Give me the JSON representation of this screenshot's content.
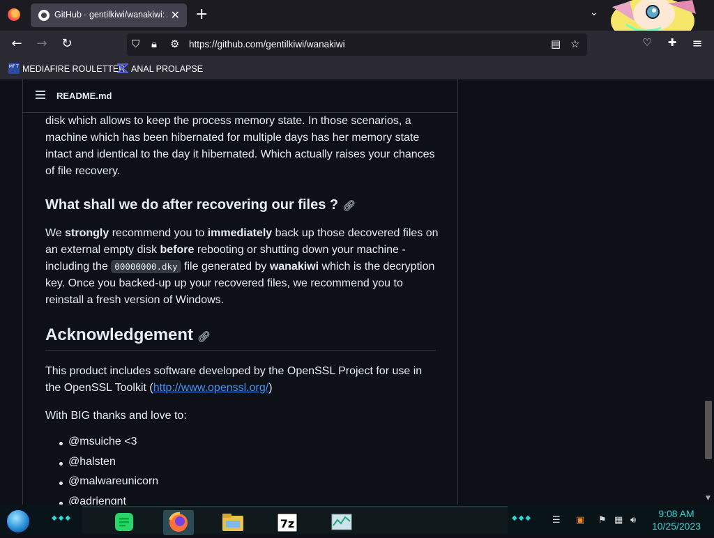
{
  "browser": {
    "tab_title": "GitHub - gentilkiwi/wanakiwi: A",
    "tab_close": "✕",
    "new_tab": "+",
    "url": "https://github.com/gentilkiwi/wanakiwi"
  },
  "bookmarks": [
    {
      "label": "MEDIAFIRE ROULETTER",
      "icon_text": "MF T"
    },
    {
      "label": "ANAL PROLAPSE"
    }
  ],
  "readme": {
    "file_name": "README.md",
    "para1": "disk which allows to keep the process memory state. In those scenarios, a machine which has been hibernated for multiple days has her memory state intact and identical to the day it hibernated. Which actually raises your chances of file recovery.",
    "h3": "What shall we do after recovering our files ?",
    "p2": {
      "t1": "We ",
      "b1": "strongly",
      "t2": " recommend you to ",
      "b2": "immediately",
      "t3": " back up those decovered files on an external empty disk ",
      "b3": "before",
      "t4": " rebooting or shutting down your machine - including the ",
      "code": "00000000.dky",
      "t5": " file generated by ",
      "b4": "wanakiwi",
      "t6": " which is the decryption key. Once you backed-up up your recovered files, we recommend you to reinstall a fresh version of Windows."
    },
    "h2": "Acknowledgement",
    "p3": {
      "t1": "This product includes software developed by the OpenSSL Project for use in the OpenSSL Toolkit (",
      "link": "http://www.openssl.org/",
      "t2": ")"
    },
    "p4": "With BIG thanks and love to:",
    "thanks": [
      "@msuiche <3",
      "@halsten",
      "@malwareunicorn",
      "@adriengnt"
    ]
  },
  "taskbar": {
    "time": "9:08 AM",
    "date": "10/25/2023",
    "apps": [
      "notes-app",
      "firefox",
      "file-explorer",
      "7zip",
      "task-manager"
    ]
  },
  "colors": {
    "accent_link": "#4493f8",
    "taskbar_accent": "#2fd6d6"
  }
}
